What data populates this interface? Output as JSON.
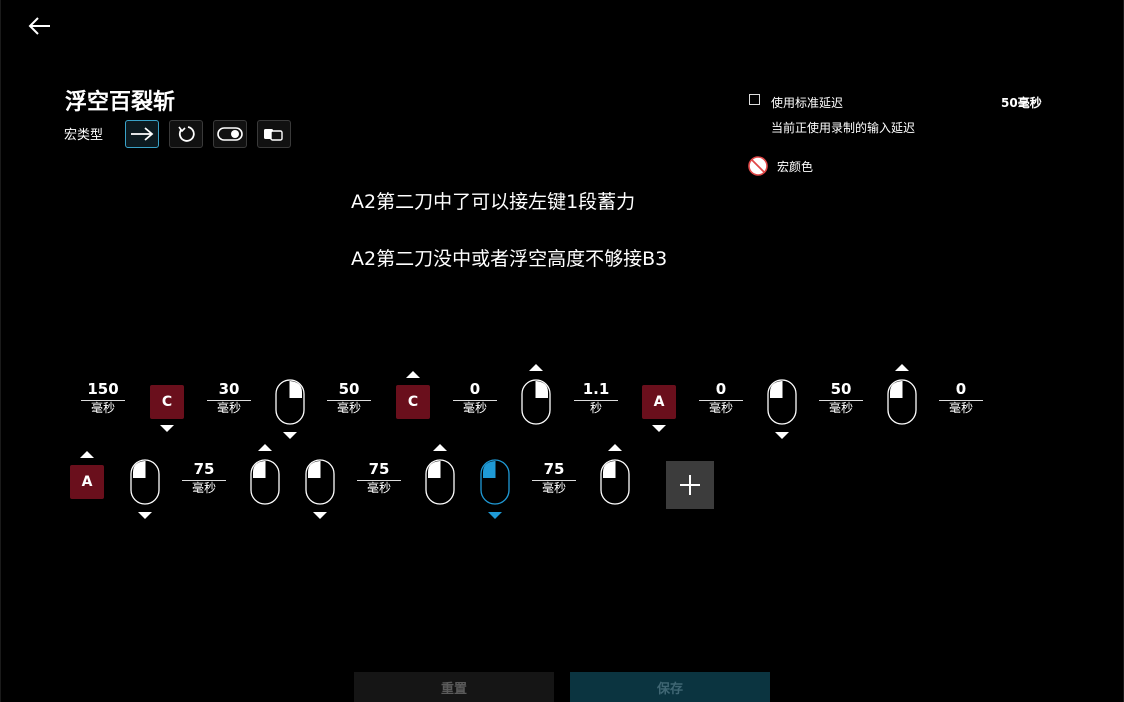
{
  "header": {
    "title": "浮空百裂斩",
    "macro_type_label": "宏类型"
  },
  "options": {
    "standard_delay_label": "使用标准延迟",
    "standard_delay_value": "50毫秒",
    "recorded_delay_note": "当前正使用录制的输入延迟",
    "macro_color_label": "宏颜色"
  },
  "notes": [
    "A2第二刀中了可以接左键1段蓄力",
    "A2第二刀没中或者浮空高度不够接B3"
  ],
  "sequence": {
    "row1": [
      {
        "kind": "delay",
        "value": "150",
        "unit": "毫秒"
      },
      {
        "kind": "key",
        "label": "C",
        "dir": "down"
      },
      {
        "kind": "delay",
        "value": "30",
        "unit": "毫秒"
      },
      {
        "kind": "mouse",
        "button": "right",
        "dir": "down"
      },
      {
        "kind": "delay",
        "value": "50",
        "unit": "毫秒"
      },
      {
        "kind": "key",
        "label": "C",
        "dir": "up"
      },
      {
        "kind": "delay",
        "value": "0",
        "unit": "毫秒"
      },
      {
        "kind": "mouse",
        "button": "right",
        "dir": "up"
      },
      {
        "kind": "delay",
        "value": "1.1",
        "unit": "秒"
      },
      {
        "kind": "key",
        "label": "A",
        "dir": "down"
      },
      {
        "kind": "delay",
        "value": "0",
        "unit": "毫秒"
      },
      {
        "kind": "mouse",
        "button": "left",
        "dir": "down"
      },
      {
        "kind": "delay",
        "value": "50",
        "unit": "毫秒"
      },
      {
        "kind": "mouse",
        "button": "left",
        "dir": "up"
      },
      {
        "kind": "delay",
        "value": "0",
        "unit": "毫秒"
      }
    ],
    "row2": [
      {
        "kind": "key",
        "label": "A",
        "dir": "up"
      },
      {
        "kind": "mouse",
        "button": "left",
        "dir": "down"
      },
      {
        "kind": "delay",
        "value": "75",
        "unit": "毫秒"
      },
      {
        "kind": "mouse",
        "button": "left",
        "dir": "up"
      },
      {
        "kind": "mouse",
        "button": "left",
        "dir": "down"
      },
      {
        "kind": "delay",
        "value": "75",
        "unit": "毫秒"
      },
      {
        "kind": "mouse",
        "button": "left",
        "dir": "up"
      },
      {
        "kind": "mouse",
        "button": "left",
        "dir": "down",
        "selected": true
      },
      {
        "kind": "delay",
        "value": "75",
        "unit": "毫秒"
      },
      {
        "kind": "mouse",
        "button": "left",
        "dir": "up"
      }
    ]
  },
  "footer": {
    "reset_label": "重置",
    "save_label": "保存"
  },
  "colors": {
    "key_bg": "#6a0f1c",
    "accent": "#1f9ad6",
    "save_bg": "#0b3440"
  },
  "icons": {
    "back": "arrow-left-icon",
    "type_once": "arrow-right-icon",
    "type_repeat": "loop-icon",
    "type_toggle": "toggle-icon",
    "type_sequence": "sequence-icon",
    "add": "plus-icon",
    "no_color": "no-color-icon"
  }
}
